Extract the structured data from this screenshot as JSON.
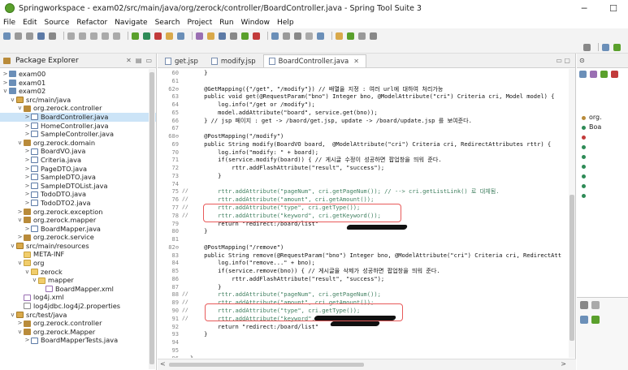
{
  "window": {
    "title": "Springworkspace - exam02/src/main/java/org/zerock/controller/BoardController.java - Spring Tool Suite 3",
    "minimize": "─",
    "maximize": "☐"
  },
  "menu": [
    "File",
    "Edit",
    "Source",
    "Refactor",
    "Navigate",
    "Search",
    "Project",
    "Run",
    "Window",
    "Help"
  ],
  "package_explorer": {
    "title": "Package Explorer",
    "items": [
      {
        "label": "exam00",
        "indent": 0,
        "twisty": ">",
        "icon": "project"
      },
      {
        "label": "exam01",
        "indent": 0,
        "twisty": ">",
        "icon": "project"
      },
      {
        "label": "exam02",
        "indent": 0,
        "twisty": "v",
        "icon": "project"
      },
      {
        "label": "src/main/java",
        "indent": 1,
        "twisty": "v",
        "icon": "srcfolder"
      },
      {
        "label": "org.zerock.controller",
        "indent": 2,
        "twisty": "v",
        "icon": "package"
      },
      {
        "label": "BoardController.java",
        "indent": 3,
        "twisty": ">",
        "icon": "java",
        "selected": true
      },
      {
        "label": "HomeController.java",
        "indent": 3,
        "twisty": ">",
        "icon": "java"
      },
      {
        "label": "SampleController.java",
        "indent": 3,
        "twisty": ">",
        "icon": "java"
      },
      {
        "label": "org.zerock.domain",
        "indent": 2,
        "twisty": "v",
        "icon": "package"
      },
      {
        "label": "BoardVO.java",
        "indent": 3,
        "twisty": ">",
        "icon": "java"
      },
      {
        "label": "Criteria.java",
        "indent": 3,
        "twisty": ">",
        "icon": "java"
      },
      {
        "label": "PageDTO.java",
        "indent": 3,
        "twisty": ">",
        "icon": "java"
      },
      {
        "label": "SampleDTO.java",
        "indent": 3,
        "twisty": ">",
        "icon": "java"
      },
      {
        "label": "SampleDTOList.java",
        "indent": 3,
        "twisty": ">",
        "icon": "java"
      },
      {
        "label": "TodoDTO.java",
        "indent": 3,
        "twisty": ">",
        "icon": "java"
      },
      {
        "label": "TodoDTO2.java",
        "indent": 3,
        "twisty": ">",
        "icon": "java"
      },
      {
        "label": "org.zerock.exception",
        "indent": 2,
        "twisty": ">",
        "icon": "package"
      },
      {
        "label": "org.zerock.mapper",
        "indent": 2,
        "twisty": "v",
        "icon": "package"
      },
      {
        "label": "BoardMapper.java",
        "indent": 3,
        "twisty": ">",
        "icon": "java"
      },
      {
        "label": "org.zerock.service",
        "indent": 2,
        "twisty": ">",
        "icon": "package"
      },
      {
        "label": "src/main/resources",
        "indent": 1,
        "twisty": "v",
        "icon": "srcfolder"
      },
      {
        "label": "META-INF",
        "indent": 2,
        "twisty": "",
        "icon": "folder"
      },
      {
        "label": "org",
        "indent": 2,
        "twisty": "v",
        "icon": "folder"
      },
      {
        "label": "zerock",
        "indent": 3,
        "twisty": "v",
        "icon": "folder"
      },
      {
        "label": "mapper",
        "indent": 4,
        "twisty": "v",
        "icon": "folder"
      },
      {
        "label": "BoardMapper.xml",
        "indent": 5,
        "twisty": "",
        "icon": "xml"
      },
      {
        "label": "log4j.xml",
        "indent": 2,
        "twisty": "",
        "icon": "xml"
      },
      {
        "label": "log4jdbc.log4j2.properties",
        "indent": 2,
        "twisty": "",
        "icon": "file"
      },
      {
        "label": "src/test/java",
        "indent": 1,
        "twisty": "v",
        "icon": "srcfolder"
      },
      {
        "label": "org.zerock.controller",
        "indent": 2,
        "twisty": ">",
        "icon": "package"
      },
      {
        "label": "org.zerock.Mapper",
        "indent": 2,
        "twisty": "v",
        "icon": "package"
      },
      {
        "label": "BoardMapperTests.java",
        "indent": 3,
        "twisty": ">",
        "icon": "java"
      }
    ]
  },
  "editor": {
    "tabs": [
      {
        "label": "get.jsp",
        "active": false
      },
      {
        "label": "modify.jsp",
        "active": false
      },
      {
        "label": "BoardController.java",
        "active": true
      }
    ],
    "lines": [
      {
        "n": "60",
        "m": "",
        "t": "    }",
        "c": ""
      },
      {
        "n": "61",
        "m": "",
        "t": "",
        "c": ""
      },
      {
        "n": "62⊖",
        "m": "",
        "t": "    @GetMapping({\"/get\", \"/modify\"}) // 배열을 지정 : 여러 url에 대하여 처리가능",
        "c": ""
      },
      {
        "n": "63",
        "m": "",
        "t": "    public void get(@RequestParam(\"bno\") Integer bno, @ModelAttribute(\"cri\") Criteria cri, Model model) {",
        "c": ""
      },
      {
        "n": "64",
        "m": "",
        "t": "        log.info(\"/get or /modify\");",
        "c": ""
      },
      {
        "n": "65",
        "m": "",
        "t": "        model.addAttribute(\"board\", service.get(bno));",
        "c": ""
      },
      {
        "n": "66",
        "m": "",
        "t": "    } // jsp 페이지 : get -> /baord/get.jsp, update -> /board/update.jsp 를 보여준다.",
        "c": ""
      },
      {
        "n": "67",
        "m": "",
        "t": "",
        "c": ""
      },
      {
        "n": "68⊖",
        "m": "",
        "t": "    @PostMapping(\"/modify\")",
        "c": ""
      },
      {
        "n": "69",
        "m": "",
        "t": "    public String modify(BoardVO board,  @ModelAttribute(\"cri\") Criteria cri, RedirectAttributes rttr) {",
        "c": ""
      },
      {
        "n": "70",
        "m": "",
        "t": "        log.info(\"modify: \" + board);",
        "c": ""
      },
      {
        "n": "71",
        "m": "",
        "t": "        if(service.modify(board)) { // 게시글 수정이 성공하면 팝업창을 띄워 준다.",
        "c": ""
      },
      {
        "n": "72",
        "m": "",
        "t": "            rttr.addFlashAttribute(\"result\", \"success\");",
        "c": ""
      },
      {
        "n": "73",
        "m": "",
        "t": "        }",
        "c": ""
      },
      {
        "n": "74",
        "m": "",
        "t": "",
        "c": ""
      },
      {
        "n": "75",
        "m": "//",
        "t": "        rttr.addAttribute(\"pageNum\", cri.getPageNum()); // --> cri.getListLink() 로 대체됨.",
        "c": "comment"
      },
      {
        "n": "76",
        "m": "//",
        "t": "        rttr.addAttribute(\"amount\", cri.getAmount());",
        "c": "comment"
      },
      {
        "n": "77",
        "m": "//",
        "t": "        rttr.addAttribute(\"type\", cri.getType());",
        "c": "comment"
      },
      {
        "n": "78",
        "m": "//",
        "t": "        rttr.addAttribute(\"keyword\", cri.getKeyword());",
        "c": "comment"
      },
      {
        "n": "79",
        "m": "",
        "t": "        return \"redirect:/board/list\"",
        "c": ""
      },
      {
        "n": "80",
        "m": "",
        "t": "    }",
        "c": ""
      },
      {
        "n": "81",
        "m": "",
        "t": "",
        "c": ""
      },
      {
        "n": "82⊖",
        "m": "",
        "t": "    @PostMapping(\"/remove\")",
        "c": ""
      },
      {
        "n": "83",
        "m": "",
        "t": "    public String remove(@RequestParam(\"bno\") Integer bno, @ModelAttribute(\"cri\") Criteria cri, RedirectAtt",
        "c": ""
      },
      {
        "n": "84",
        "m": "",
        "t": "        log.info(\"remove...\" + bno);",
        "c": ""
      },
      {
        "n": "85",
        "m": "",
        "t": "        if(service.remove(bno)) { // 게시글을 삭제가 성공하면 팝업창을 띄워 준다.",
        "c": ""
      },
      {
        "n": "86",
        "m": "",
        "t": "            rttr.addFlashAttribute(\"result\", \"success\");",
        "c": ""
      },
      {
        "n": "87",
        "m": "",
        "t": "        }",
        "c": ""
      },
      {
        "n": "88",
        "m": "//",
        "t": "        rttr.addAttribute(\"pageNum\", cri.getPageNum());",
        "c": "comment"
      },
      {
        "n": "89",
        "m": "//",
        "t": "        rttr.addAttribute(\"amount\", cri.getAmount());",
        "c": "comment"
      },
      {
        "n": "90",
        "m": "//",
        "t": "        rttr.addAttribute(\"type\", cri.getType());",
        "c": "comment"
      },
      {
        "n": "91",
        "m": "//",
        "t": "        rttr.addAttribute(\"keyword\", cri.getKeyword());",
        "c": "comment"
      },
      {
        "n": "92",
        "m": "",
        "t": "        return \"redirect:/board/list\"",
        "c": ""
      },
      {
        "n": "93",
        "m": "",
        "t": "    }",
        "c": ""
      },
      {
        "n": "94",
        "m": "",
        "t": "",
        "c": ""
      },
      {
        "n": "95",
        "m": "",
        "t": "",
        "c": ""
      },
      {
        "n": "96",
        "m": "",
        "t": "}",
        "c": ""
      }
    ]
  },
  "outline": {
    "items": [
      {
        "label": "org.",
        "color": "#b98b3a"
      },
      {
        "label": "Boa",
        "color": "#2e8b57"
      },
      {
        "label": "",
        "color": "#c23b3b"
      },
      {
        "label": "",
        "color": "#2e8b57"
      },
      {
        "label": "",
        "color": "#2e8b57"
      },
      {
        "label": "",
        "color": "#2e8b57"
      },
      {
        "label": "",
        "color": "#2e8b57"
      },
      {
        "label": "",
        "color": "#2e8b57"
      },
      {
        "label": "",
        "color": "#2e8b57"
      }
    ]
  }
}
